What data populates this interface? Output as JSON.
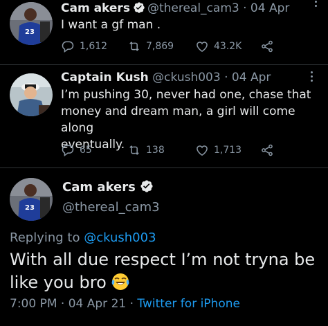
{
  "tweets": [
    {
      "name": "Cam akers",
      "handle": "@thereal_cam3",
      "sep": "·",
      "date": "04 Apr",
      "text_lines": [
        "I want a gf man ."
      ],
      "replies": "1,612",
      "retweets": "7,869",
      "likes": "43.2K",
      "verified": true
    },
    {
      "name": "Captain Kush",
      "handle": "@ckush003",
      "sep": "·",
      "date": "04 Apr",
      "text_lines": [
        "I’m pushing 30, never had one, chase that",
        "money and dream man, a girl will come along",
        "eventually."
      ],
      "replies": "65",
      "retweets": "138",
      "likes": "1,713",
      "verified": false
    }
  ],
  "main_tweet": {
    "name": "Cam akers",
    "handle": "@thereal_cam3",
    "replying_prefix": "Replying to ",
    "replying_to": "@ckush003",
    "text_line1": "With all due respect I’m not tryna be",
    "text_line2": "like you bro",
    "emoji": "face-with-tears-of-joy",
    "time": "7:00 PM",
    "sep": "·",
    "date": "04 Apr 21",
    "sep2": "·",
    "source": "Twitter for iPhone"
  },
  "colors": {
    "background": "#000000",
    "text": "#e7e9ea",
    "secondary": "#8b98a5",
    "accent": "#1d9bf0"
  },
  "icons": [
    "reply-icon",
    "retweet-icon",
    "like-icon",
    "share-icon",
    "verified-icon",
    "more-icon"
  ]
}
